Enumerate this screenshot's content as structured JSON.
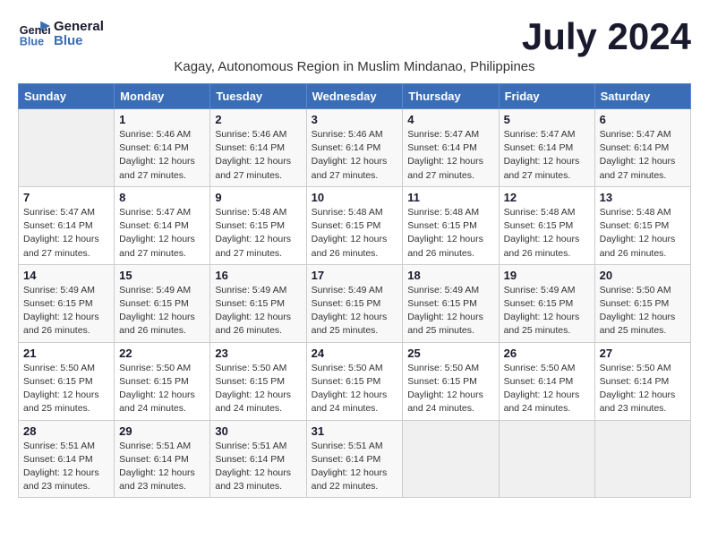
{
  "logo": {
    "line1": "General",
    "line2": "Blue"
  },
  "title": "July 2024",
  "subtitle": "Kagay, Autonomous Region in Muslim Mindanao, Philippines",
  "days_of_week": [
    "Sunday",
    "Monday",
    "Tuesday",
    "Wednesday",
    "Thursday",
    "Friday",
    "Saturday"
  ],
  "weeks": [
    [
      {
        "day": "",
        "info": ""
      },
      {
        "day": "1",
        "info": "Sunrise: 5:46 AM\nSunset: 6:14 PM\nDaylight: 12 hours\nand 27 minutes."
      },
      {
        "day": "2",
        "info": "Sunrise: 5:46 AM\nSunset: 6:14 PM\nDaylight: 12 hours\nand 27 minutes."
      },
      {
        "day": "3",
        "info": "Sunrise: 5:46 AM\nSunset: 6:14 PM\nDaylight: 12 hours\nand 27 minutes."
      },
      {
        "day": "4",
        "info": "Sunrise: 5:47 AM\nSunset: 6:14 PM\nDaylight: 12 hours\nand 27 minutes."
      },
      {
        "day": "5",
        "info": "Sunrise: 5:47 AM\nSunset: 6:14 PM\nDaylight: 12 hours\nand 27 minutes."
      },
      {
        "day": "6",
        "info": "Sunrise: 5:47 AM\nSunset: 6:14 PM\nDaylight: 12 hours\nand 27 minutes."
      }
    ],
    [
      {
        "day": "7",
        "info": "Sunrise: 5:47 AM\nSunset: 6:14 PM\nDaylight: 12 hours\nand 27 minutes."
      },
      {
        "day": "8",
        "info": "Sunrise: 5:47 AM\nSunset: 6:14 PM\nDaylight: 12 hours\nand 27 minutes."
      },
      {
        "day": "9",
        "info": "Sunrise: 5:48 AM\nSunset: 6:15 PM\nDaylight: 12 hours\nand 27 minutes."
      },
      {
        "day": "10",
        "info": "Sunrise: 5:48 AM\nSunset: 6:15 PM\nDaylight: 12 hours\nand 26 minutes."
      },
      {
        "day": "11",
        "info": "Sunrise: 5:48 AM\nSunset: 6:15 PM\nDaylight: 12 hours\nand 26 minutes."
      },
      {
        "day": "12",
        "info": "Sunrise: 5:48 AM\nSunset: 6:15 PM\nDaylight: 12 hours\nand 26 minutes."
      },
      {
        "day": "13",
        "info": "Sunrise: 5:48 AM\nSunset: 6:15 PM\nDaylight: 12 hours\nand 26 minutes."
      }
    ],
    [
      {
        "day": "14",
        "info": "Sunrise: 5:49 AM\nSunset: 6:15 PM\nDaylight: 12 hours\nand 26 minutes."
      },
      {
        "day": "15",
        "info": "Sunrise: 5:49 AM\nSunset: 6:15 PM\nDaylight: 12 hours\nand 26 minutes."
      },
      {
        "day": "16",
        "info": "Sunrise: 5:49 AM\nSunset: 6:15 PM\nDaylight: 12 hours\nand 26 minutes."
      },
      {
        "day": "17",
        "info": "Sunrise: 5:49 AM\nSunset: 6:15 PM\nDaylight: 12 hours\nand 25 minutes."
      },
      {
        "day": "18",
        "info": "Sunrise: 5:49 AM\nSunset: 6:15 PM\nDaylight: 12 hours\nand 25 minutes."
      },
      {
        "day": "19",
        "info": "Sunrise: 5:49 AM\nSunset: 6:15 PM\nDaylight: 12 hours\nand 25 minutes."
      },
      {
        "day": "20",
        "info": "Sunrise: 5:50 AM\nSunset: 6:15 PM\nDaylight: 12 hours\nand 25 minutes."
      }
    ],
    [
      {
        "day": "21",
        "info": "Sunrise: 5:50 AM\nSunset: 6:15 PM\nDaylight: 12 hours\nand 25 minutes."
      },
      {
        "day": "22",
        "info": "Sunrise: 5:50 AM\nSunset: 6:15 PM\nDaylight: 12 hours\nand 24 minutes."
      },
      {
        "day": "23",
        "info": "Sunrise: 5:50 AM\nSunset: 6:15 PM\nDaylight: 12 hours\nand 24 minutes."
      },
      {
        "day": "24",
        "info": "Sunrise: 5:50 AM\nSunset: 6:15 PM\nDaylight: 12 hours\nand 24 minutes."
      },
      {
        "day": "25",
        "info": "Sunrise: 5:50 AM\nSunset: 6:15 PM\nDaylight: 12 hours\nand 24 minutes."
      },
      {
        "day": "26",
        "info": "Sunrise: 5:50 AM\nSunset: 6:14 PM\nDaylight: 12 hours\nand 24 minutes."
      },
      {
        "day": "27",
        "info": "Sunrise: 5:50 AM\nSunset: 6:14 PM\nDaylight: 12 hours\nand 23 minutes."
      }
    ],
    [
      {
        "day": "28",
        "info": "Sunrise: 5:51 AM\nSunset: 6:14 PM\nDaylight: 12 hours\nand 23 minutes."
      },
      {
        "day": "29",
        "info": "Sunrise: 5:51 AM\nSunset: 6:14 PM\nDaylight: 12 hours\nand 23 minutes."
      },
      {
        "day": "30",
        "info": "Sunrise: 5:51 AM\nSunset: 6:14 PM\nDaylight: 12 hours\nand 23 minutes."
      },
      {
        "day": "31",
        "info": "Sunrise: 5:51 AM\nSunset: 6:14 PM\nDaylight: 12 hours\nand 22 minutes."
      },
      {
        "day": "",
        "info": ""
      },
      {
        "day": "",
        "info": ""
      },
      {
        "day": "",
        "info": ""
      }
    ]
  ]
}
